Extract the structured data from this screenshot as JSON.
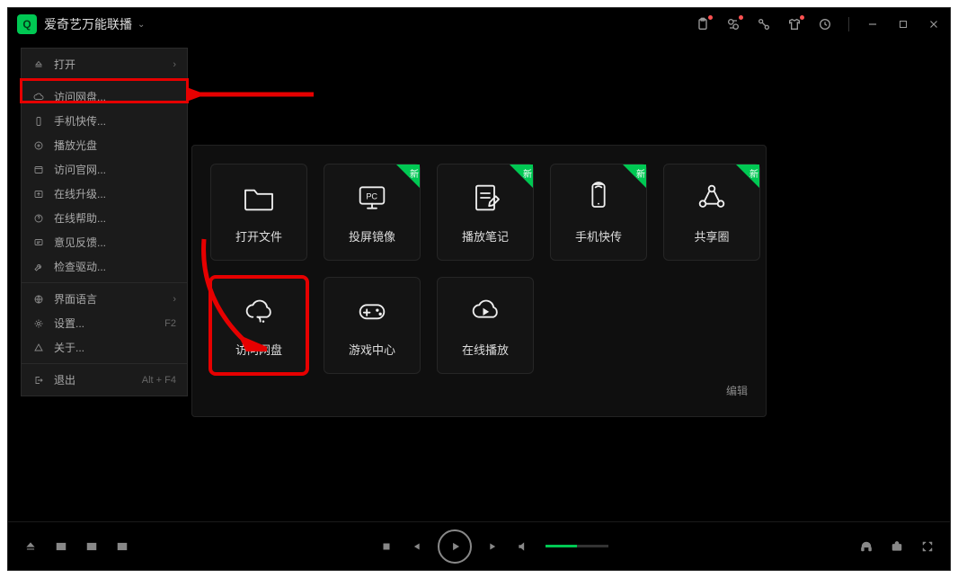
{
  "title": "爱奇艺万能联播",
  "titlebar_icons": [
    "clipboard",
    "cloud",
    "connect",
    "tshirt",
    "history"
  ],
  "menu": [
    {
      "label": "打开",
      "tail": "›",
      "icon": "eject"
    },
    {
      "label": "访问网盘...",
      "tail": "",
      "icon": "cloud"
    },
    {
      "label": "手机快传...",
      "tail": "",
      "icon": "phone"
    },
    {
      "label": "播放光盘",
      "tail": "",
      "icon": "disc"
    },
    {
      "label": "访问官网...",
      "tail": "",
      "icon": "globe"
    },
    {
      "label": "在线升级...",
      "tail": "",
      "icon": "upgrade"
    },
    {
      "label": "在线帮助...",
      "tail": "",
      "icon": "help"
    },
    {
      "label": "意见反馈...",
      "tail": "",
      "icon": "feedback"
    },
    {
      "label": "检查驱动...",
      "tail": "",
      "icon": "wrench"
    },
    {
      "label": "界面语言",
      "tail": "›",
      "icon": "lang"
    },
    {
      "label": "设置...",
      "tail": "F2",
      "icon": "gear"
    },
    {
      "label": "关于...",
      "tail": "",
      "icon": "about"
    },
    {
      "label": "退出",
      "tail": "Alt + F4",
      "icon": "exit"
    }
  ],
  "menu_separators_after": [
    0,
    8,
    11
  ],
  "tiles": [
    {
      "label": "打开文件",
      "icon": "folder",
      "new": false
    },
    {
      "label": "投屏镜像",
      "icon": "pc",
      "new": true
    },
    {
      "label": "播放笔记",
      "icon": "note",
      "new": true
    },
    {
      "label": "手机快传",
      "icon": "phone",
      "new": true
    },
    {
      "label": "共享圈",
      "icon": "share",
      "new": true
    },
    {
      "label": "访问网盘",
      "icon": "cloud",
      "new": false,
      "highlight": true
    },
    {
      "label": "游戏中心",
      "icon": "gamepad",
      "new": false
    },
    {
      "label": "在线播放",
      "icon": "playcloud",
      "new": false
    }
  ],
  "panel_edit": "编辑"
}
